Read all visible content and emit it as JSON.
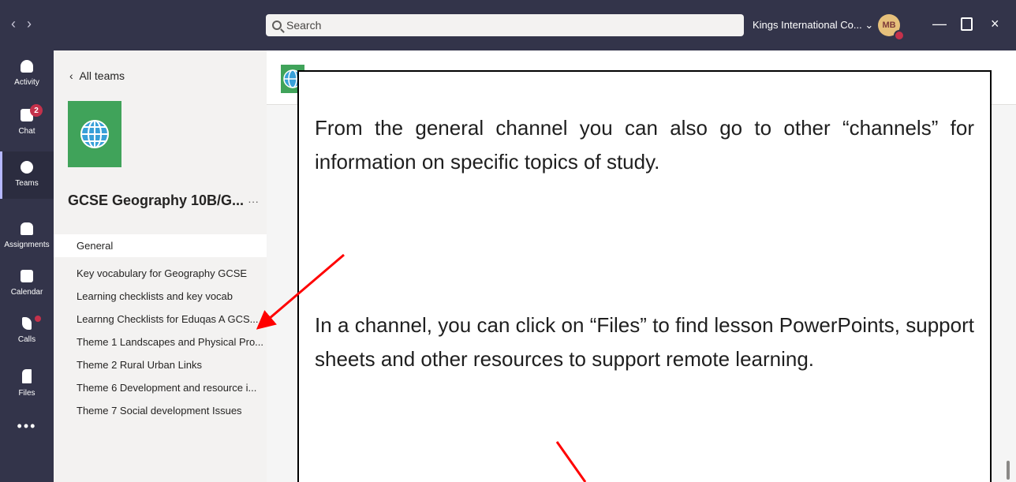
{
  "titlebar": {
    "search_placeholder": "Search",
    "org_name": "Kings International Co...",
    "avatar_initials": "MB",
    "colors": {
      "bar": "#33344a",
      "accent": "#b6b8ff",
      "badge": "#c4314b"
    }
  },
  "rail": {
    "items": [
      {
        "label": "Activity",
        "icon": "bell-icon"
      },
      {
        "label": "Chat",
        "icon": "chat-icon",
        "badge": "2"
      },
      {
        "label": "Teams",
        "icon": "teams-icon"
      },
      {
        "label": "Assignments",
        "icon": "backpack-icon"
      },
      {
        "label": "Calendar",
        "icon": "calendar-icon"
      },
      {
        "label": "Calls",
        "icon": "phone-icon"
      },
      {
        "label": "Files",
        "icon": "file-icon"
      }
    ],
    "more": "•••"
  },
  "team": {
    "back_label": "All teams",
    "name": "GCSE Geography 10B/G...",
    "more": "···",
    "channels": [
      "General",
      "Key vocabulary for Geography GCSE",
      "Learning checklists and key vocab",
      "Learnng Checklists for Eduqas A GCS...",
      "Theme 1 Landscapes and Physical Pro...",
      "Theme 2 Rural Urban Links",
      "Theme 6 Development and resource i...",
      "Theme 7 Social development Issues"
    ]
  },
  "callout": {
    "paragraph1": "From the general channel you can also go to other “channels” for information on specific topics of study.",
    "paragraph2": "In a channel, you can click on “Files” to find lesson PowerPoints, support sheets and other resources to support remote learning."
  }
}
